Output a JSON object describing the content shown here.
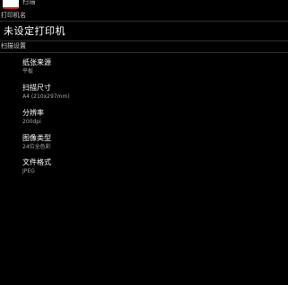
{
  "app": {
    "title": "扫描",
    "icon": "app-logo-icon"
  },
  "printer_section": {
    "header": "打印机名",
    "printer_name": "未设定打印机"
  },
  "scan_section": {
    "header": "扫描设置",
    "settings": [
      {
        "title": "纸张来源",
        "value": "平板"
      },
      {
        "title": "扫描尺寸",
        "value": "A4 (210x297mm)"
      },
      {
        "title": "分辨率",
        "value": "200dpi"
      },
      {
        "title": "图像类型",
        "value": "24位全色彩"
      },
      {
        "title": "文件格式",
        "value": "JPEG"
      }
    ]
  },
  "colors": {
    "background": "#000000",
    "divider": "#2e2e2e",
    "primary_text": "#ffffff",
    "secondary_text": "#a8a8a8",
    "icon_accent": "#c62828"
  }
}
